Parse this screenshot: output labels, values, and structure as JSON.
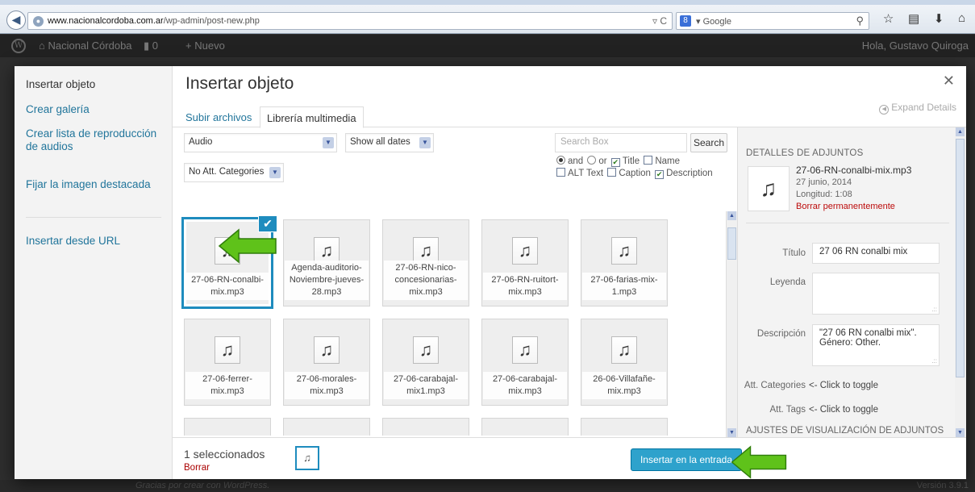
{
  "browser": {
    "url_domain": "www.nacionalcordoba.com.ar",
    "url_path": "/wp-admin/post-new.php",
    "search_engine": "Google"
  },
  "admin_bar": {
    "site_name": "Nacional Córdoba",
    "comments_count": "0",
    "new_label": "Nuevo",
    "greeting": "Hola, Gustavo Quiroga"
  },
  "footer": {
    "credit": "Gracias por crear con WordPress.",
    "version": "Versión 3.9.1"
  },
  "menu": {
    "items": [
      {
        "label": "Insertar objeto"
      },
      {
        "label": "Crear galería"
      },
      {
        "label": "Crear lista de reproducción de audios"
      },
      {
        "label": "Fijar la imagen destacada"
      },
      {
        "label": "Insertar desde URL"
      }
    ]
  },
  "frame": {
    "title": "Insertar objeto",
    "tabs": [
      {
        "label": "Subir archivos"
      },
      {
        "label": "Librería multimedia"
      }
    ],
    "expand_label": "Expand Details"
  },
  "toolbar": {
    "type_filter": "Audio",
    "date_filter": "Show all dates",
    "category_filter": "No Att. Categories",
    "search_placeholder": "Search Box",
    "search_button": "Search",
    "opt_and": "and",
    "opt_or": "or",
    "opt_title": "Title",
    "opt_name": "Name",
    "opt_alt": "ALT Text",
    "opt_caption": "Caption",
    "opt_description": "Description"
  },
  "attachments": [
    {
      "name": "27-06-RN-conalbi-mix.mp3"
    },
    {
      "name": "Agenda-auditorio-Noviembre-jueves-28.mp3"
    },
    {
      "name": "27-06-RN-nico-concesionarias-mix.mp3"
    },
    {
      "name": "27-06-RN-ruitort-mix.mp3"
    },
    {
      "name": "27-06-farias-mix-1.mp3"
    },
    {
      "name": "27-06-ferrer-mix.mp3"
    },
    {
      "name": "27-06-morales-mix.mp3"
    },
    {
      "name": "27-06-carabajal-mix1.mp3"
    },
    {
      "name": "27-06-carabajal-mix.mp3"
    },
    {
      "name": "26-06-Villafañe-mix.mp3"
    }
  ],
  "details": {
    "heading": "DETALLES DE ADJUNTOS",
    "filename": "27-06-RN-conalbi-mix.mp3",
    "date": "27 junio, 2014",
    "length": "Longitud: 1:08",
    "delete_label": "Borrar permanentemente",
    "title_label": "Título",
    "title_value": "27 06 RN conalbi mix",
    "caption_label": "Leyenda",
    "caption_value": "",
    "desc_label": "Descripción",
    "desc_value": "\"27 06 RN conalbi mix\". Género: Other.",
    "cat_label": "Att. Categories",
    "cat_toggle": "<- Click to toggle",
    "tags_label": "Att. Tags",
    "tags_toggle": "<- Click to toggle",
    "display_heading": "AJUSTES DE VISUALIZACIÓN DE ADJUNTOS"
  },
  "bottom": {
    "selected_count": "1 seleccionados",
    "clear_label": "Borrar",
    "insert_label": "Insertar en la entrada"
  },
  "colors": {
    "accent": "#2ea2cc",
    "link": "#21759b",
    "selection": "#1e8cbe",
    "annotation_arrow": "#5fc21a"
  }
}
